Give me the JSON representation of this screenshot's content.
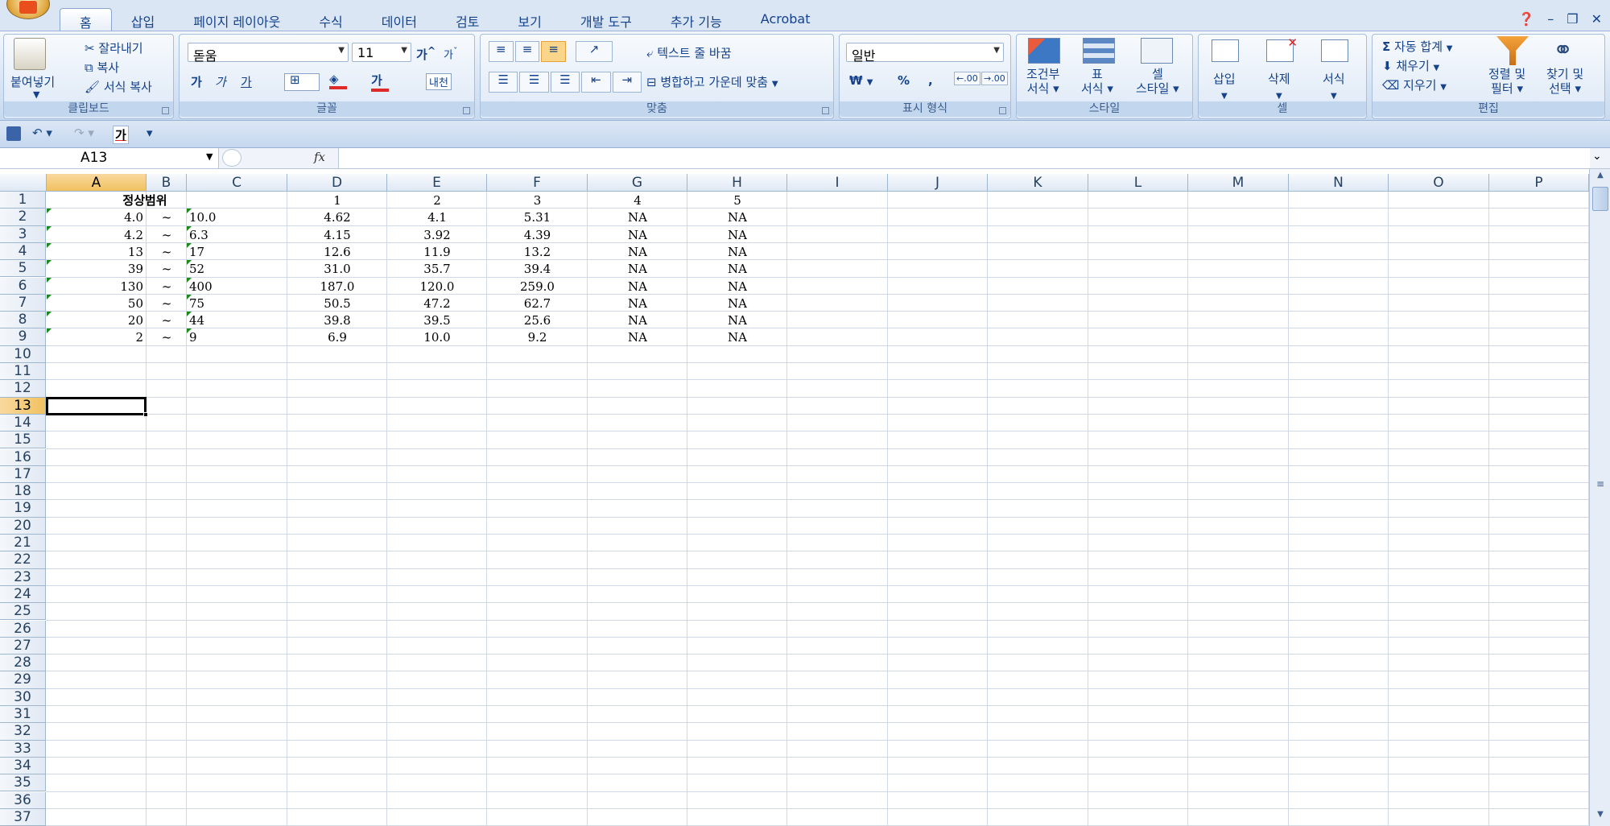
{
  "tabs": [
    {
      "label": "홈",
      "active": true
    },
    {
      "label": "삽입"
    },
    {
      "label": "페이지 레이아웃"
    },
    {
      "label": "수식"
    },
    {
      "label": "데이터"
    },
    {
      "label": "검토"
    },
    {
      "label": "보기"
    },
    {
      "label": "개발 도구"
    },
    {
      "label": "추가 기능"
    },
    {
      "label": "Acrobat"
    }
  ],
  "ribbon": {
    "clipboard": {
      "paste": "붙여넣기",
      "cut": "잘라내기",
      "copy": "복사",
      "format_painter": "서식 복사",
      "label": "클립보드"
    },
    "font": {
      "name": "돋움",
      "size": "11",
      "grow": "가",
      "shrink": "가",
      "bold": "가",
      "italic": "가",
      "underline": "가",
      "font_color": "가",
      "phonetic": "내천",
      "label": "글꼴"
    },
    "alignment": {
      "wrap": "텍스트 줄 바꿈",
      "merge": "병합하고 가운데 맞춤",
      "label": "맞춤"
    },
    "number": {
      "format": "일반",
      "currency": "₩",
      "percent": "%",
      "comma": ",",
      "inc_dec": ".00",
      "dec_dec": ".00",
      "label": "표시 형식"
    },
    "styles": {
      "conditional_1": "조건부",
      "conditional_2": "서식",
      "table_1": "표",
      "table_2": "서식",
      "cell_1": "셀",
      "cell_2": "스타일",
      "label": "스타일"
    },
    "cells": {
      "insert": "삽입",
      "delete": "삭제",
      "format": "서식",
      "label": "셀"
    },
    "editing": {
      "autosum": "자동 합계",
      "fill": "채우기",
      "clear": "지우기",
      "sort_1": "정렬 및",
      "sort_2": "필터",
      "find_1": "찾기 및",
      "find_2": "선택",
      "label": "편집"
    }
  },
  "qat": {
    "font_btn": "가"
  },
  "formula_bar": {
    "name_box": "A13",
    "fx": "fx",
    "value": ""
  },
  "columns": [
    "A",
    "B",
    "C",
    "D",
    "E",
    "F",
    "G",
    "H",
    "I",
    "J",
    "K",
    "L",
    "M",
    "N",
    "O",
    "P"
  ],
  "selected_cell": "A13",
  "rows": [
    {
      "n": "1",
      "cells": {
        "B": "정상범위",
        "D": "1",
        "E": "2",
        "F": "3",
        "G": "4",
        "H": "5"
      }
    },
    {
      "n": "2",
      "cells": {
        "A": "4.0",
        "B": "~",
        "C": "10.0",
        "D": "4.62",
        "E": "4.1",
        "F": "5.31",
        "G": "NA",
        "H": "NA"
      }
    },
    {
      "n": "3",
      "cells": {
        "A": "4.2",
        "B": "~",
        "C": "6.3",
        "D": "4.15",
        "E": "3.92",
        "F": "4.39",
        "G": "NA",
        "H": "NA"
      }
    },
    {
      "n": "4",
      "cells": {
        "A": "13",
        "B": "~",
        "C": "17",
        "D": "12.6",
        "E": "11.9",
        "F": "13.2",
        "G": "NA",
        "H": "NA"
      }
    },
    {
      "n": "5",
      "cells": {
        "A": "39",
        "B": "~",
        "C": "52",
        "D": "31.0",
        "E": "35.7",
        "F": "39.4",
        "G": "NA",
        "H": "NA"
      }
    },
    {
      "n": "6",
      "cells": {
        "A": "130",
        "B": "~",
        "C": "400",
        "D": "187.0",
        "E": "120.0",
        "F": "259.0",
        "G": "NA",
        "H": "NA"
      }
    },
    {
      "n": "7",
      "cells": {
        "A": "50",
        "B": "~",
        "C": "75",
        "D": "50.5",
        "E": "47.2",
        "F": "62.7",
        "G": "NA",
        "H": "NA"
      }
    },
    {
      "n": "8",
      "cells": {
        "A": "20",
        "B": "~",
        "C": "44",
        "D": "39.8",
        "E": "39.5",
        "F": "25.6",
        "G": "NA",
        "H": "NA"
      }
    },
    {
      "n": "9",
      "cells": {
        "A": "2",
        "B": "~",
        "C": "9",
        "D": "6.9",
        "E": "10.0",
        "F": "9.2",
        "G": "NA",
        "H": "NA"
      }
    },
    {
      "n": "10"
    },
    {
      "n": "11"
    },
    {
      "n": "12"
    },
    {
      "n": "13"
    },
    {
      "n": "14"
    },
    {
      "n": "15"
    },
    {
      "n": "16"
    },
    {
      "n": "17"
    },
    {
      "n": "18"
    },
    {
      "n": "19"
    },
    {
      "n": "20"
    },
    {
      "n": "21"
    },
    {
      "n": "22"
    },
    {
      "n": "23"
    },
    {
      "n": "24"
    },
    {
      "n": "25"
    },
    {
      "n": "26"
    },
    {
      "n": "27"
    },
    {
      "n": "28"
    },
    {
      "n": "29"
    },
    {
      "n": "30"
    },
    {
      "n": "31"
    },
    {
      "n": "32"
    },
    {
      "n": "33"
    },
    {
      "n": "34"
    },
    {
      "n": "35"
    },
    {
      "n": "36"
    },
    {
      "n": "37"
    }
  ]
}
